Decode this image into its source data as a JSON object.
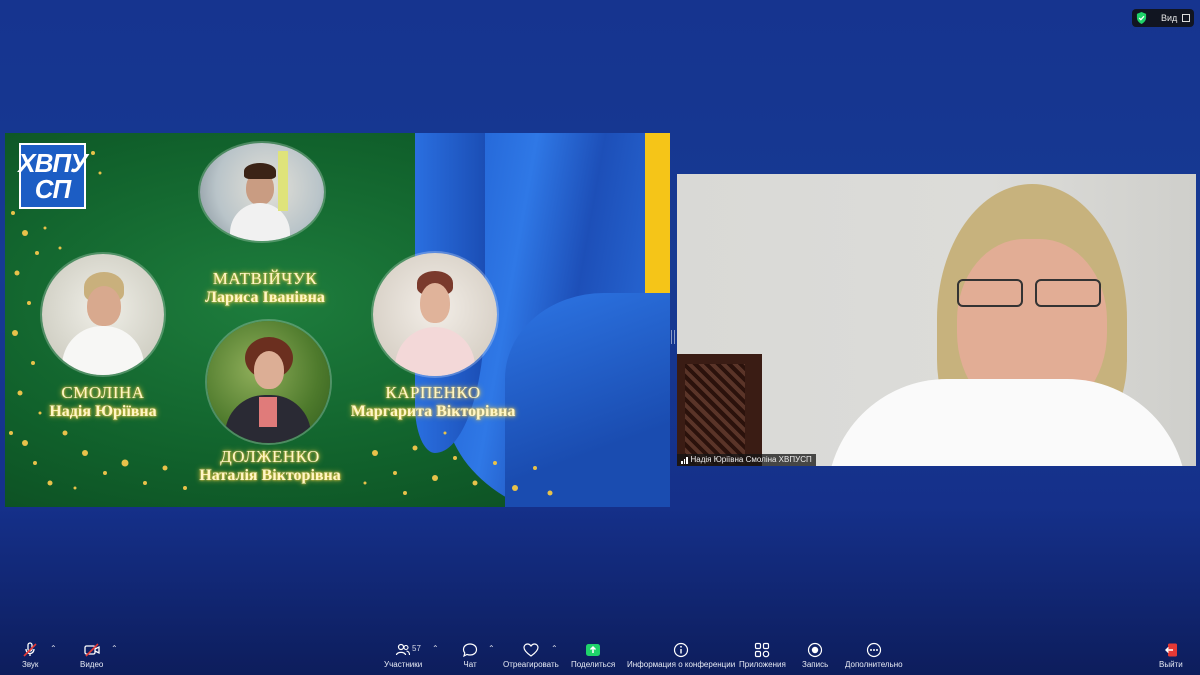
{
  "view_control": {
    "label": "Вид"
  },
  "slide": {
    "logo": [
      "ХВПУ",
      "СП"
    ],
    "people": [
      {
        "surname": "МАТВІЙЧУК",
        "given": "Лариса Іванівна"
      },
      {
        "surname": "СМОЛІНА",
        "given": "Надія Юріївна"
      },
      {
        "surname": "КАРПЕНКО",
        "given": "Маргарита Вікторівна"
      },
      {
        "surname": "ДОЛЖЕНКО",
        "given": "Наталія Вікторівна"
      }
    ]
  },
  "video": {
    "participant_name": "Надія Юріївна Смоліна ХВПУСП"
  },
  "toolbar": {
    "audio": "Звук",
    "video": "Видео",
    "participants": "Участники",
    "participants_count": "57",
    "chat": "Чат",
    "react": "Отреагировать",
    "share": "Поделиться",
    "info": "Информация о конференции",
    "apps": "Приложения",
    "record": "Запись",
    "more": "Дополнительно",
    "leave": "Выйти"
  },
  "colors": {
    "accent_green": "#1fd36a",
    "leave_red": "#e53935",
    "background": "#16348f"
  }
}
